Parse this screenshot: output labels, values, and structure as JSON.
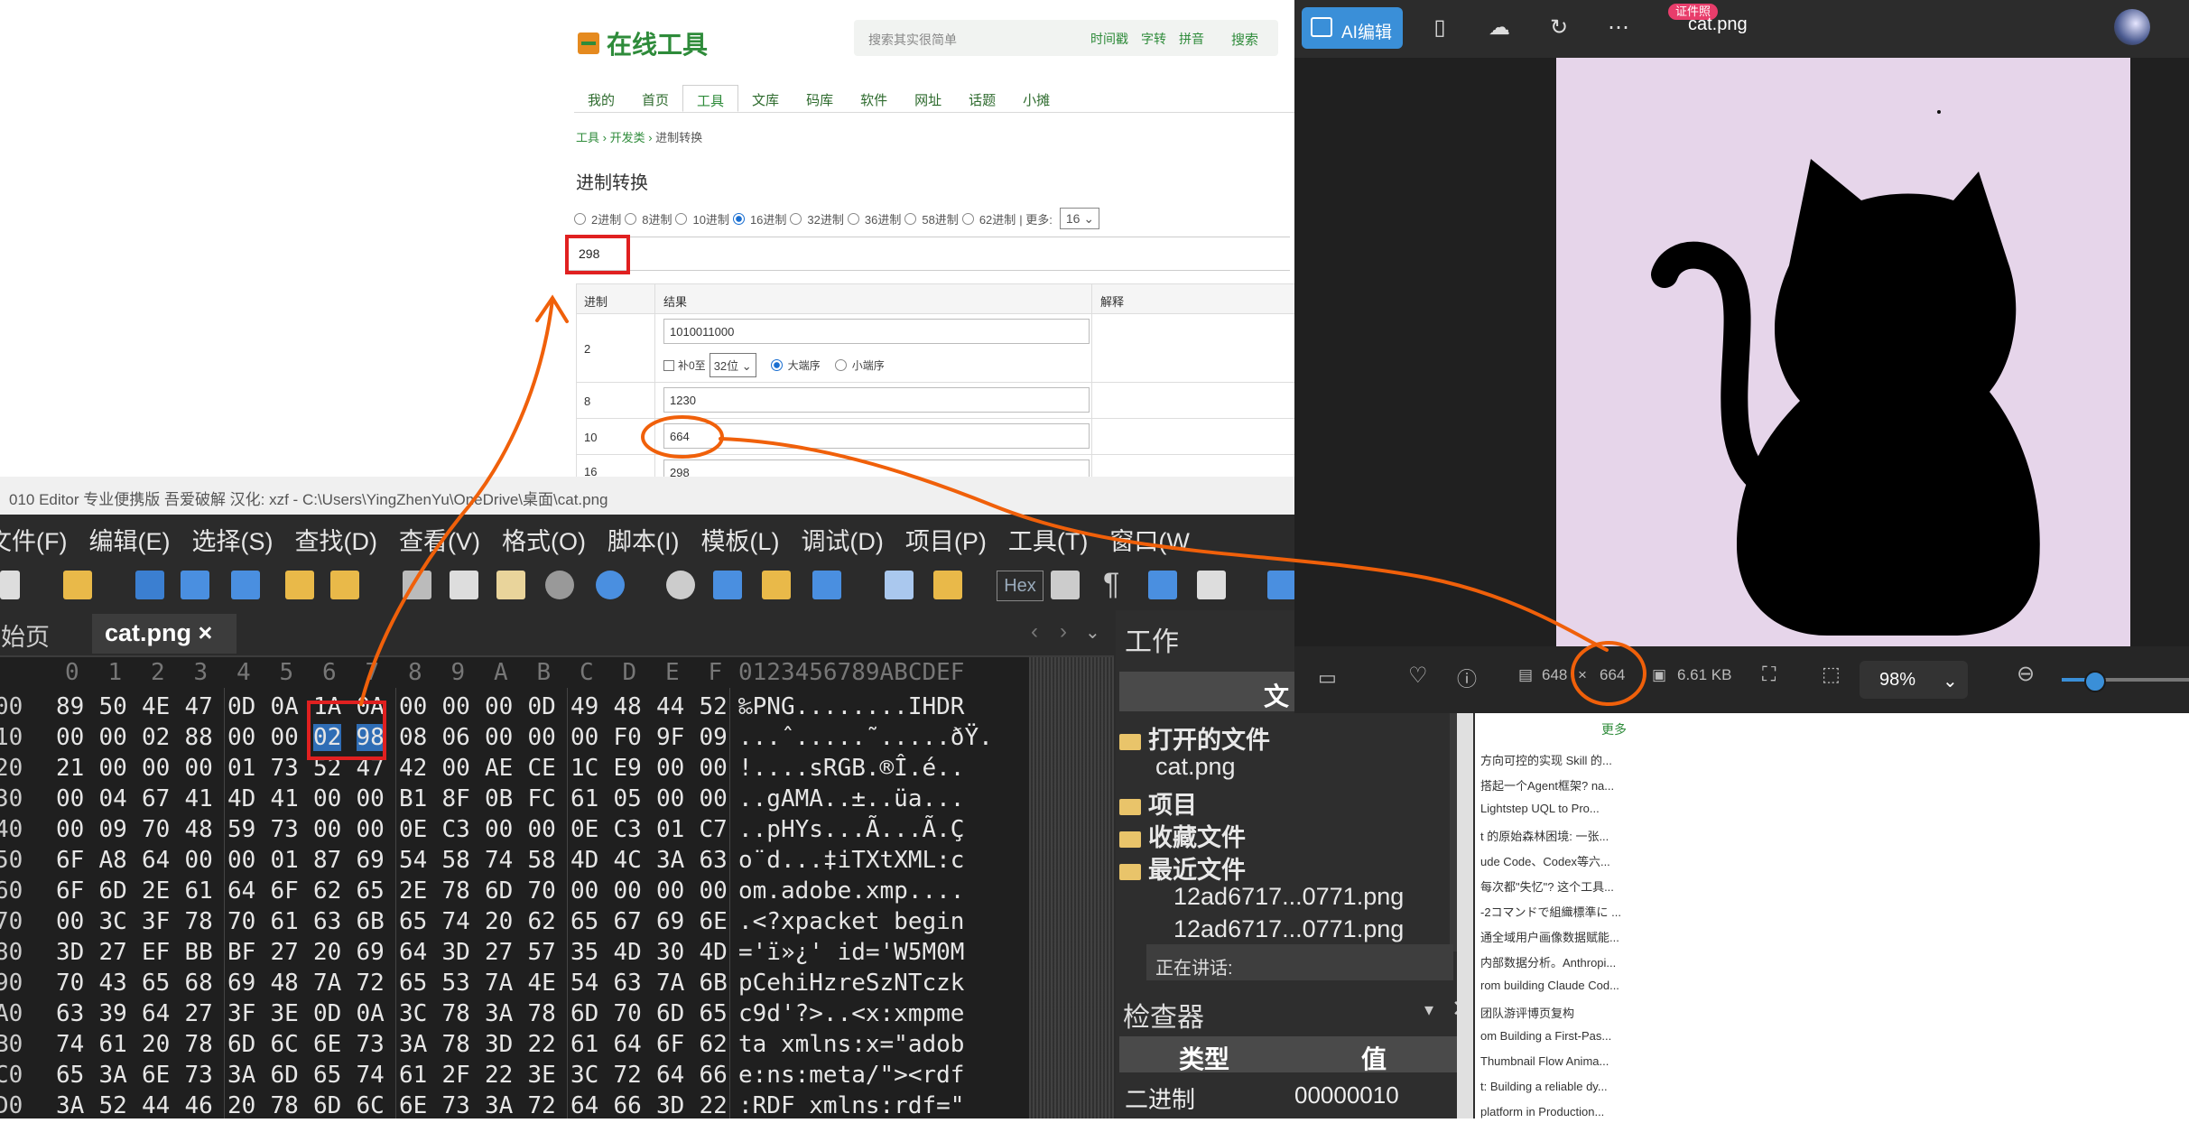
{
  "web": {
    "logo": "在线工具",
    "search_placeholder": "搜索其实很简单",
    "search_chips": [
      "时间戳",
      "字转",
      "拼音"
    ],
    "search_button": "搜索",
    "nav_tabs": [
      "我的",
      "首页",
      "工具",
      "文库",
      "码库",
      "软件",
      "网址",
      "话题",
      "小摊"
    ],
    "active_tab": "工具",
    "breadcrumb": [
      "工具",
      "开发类",
      "进制转换"
    ],
    "section_title": "进制转换",
    "bases": [
      "2进制",
      "8进制",
      "10进制",
      "16进制",
      "32进制",
      "36进制",
      "58进制",
      "62进制"
    ],
    "more_label": "| 更多:",
    "base_select_value": "16",
    "input_value": "298",
    "table_headers": [
      "进制",
      "结果",
      "解释"
    ],
    "rows": [
      {
        "base": "2",
        "value": "1010011000"
      },
      {
        "base": "8",
        "value": "1230"
      },
      {
        "base": "10",
        "value": "664"
      },
      {
        "base": "16",
        "value": "298"
      }
    ],
    "pad_zero_label": "补0至",
    "bit_select": "32位",
    "big_endian": "大端序",
    "little_endian": "小端序"
  },
  "editor": {
    "title": "010 Editor 专业便携版 吾爱破解  汉化: xzf - C:\\Users\\YingZhenYu\\OneDrive\\桌面\\cat.png",
    "menu": [
      "文件(F)",
      "编辑(E)",
      "选择(S)",
      "查找(D)",
      "查看(V)",
      "格式(O)",
      "脚本(I)",
      "模板(L)",
      "调试(D)",
      "项目(P)",
      "工具(T)",
      "窗口(W"
    ],
    "tab_start": "起始页",
    "tab_file": "cat.png ×",
    "hex_label": "Hex",
    "col_header": [
      "0",
      "1",
      "2",
      "3",
      "4",
      "5",
      "6",
      "7",
      "8",
      "9",
      "A",
      "B",
      "C",
      "D",
      "E",
      "F"
    ],
    "ascii_header": "0123456789ABCDEF",
    "rows": [
      {
        "addr": "00",
        "bytes": [
          "89",
          "50",
          "4E",
          "47",
          "0D",
          "0A",
          "1A",
          "0A",
          "00",
          "00",
          "00",
          "0D",
          "49",
          "48",
          "44",
          "52"
        ],
        "ascii": "‰PNG........IHDR"
      },
      {
        "addr": "10",
        "bytes": [
          "00",
          "00",
          "02",
          "88",
          "00",
          "00",
          "02",
          "98",
          "08",
          "06",
          "00",
          "00",
          "00",
          "F0",
          "9F",
          "09"
        ],
        "ascii": "...ˆ.....˜.....ðŸ."
      },
      {
        "addr": "20",
        "bytes": [
          "21",
          "00",
          "00",
          "00",
          "01",
          "73",
          "52",
          "47",
          "42",
          "00",
          "AE",
          "CE",
          "1C",
          "E9",
          "00",
          "00"
        ],
        "ascii": "!....sRGB.®Î.é.."
      },
      {
        "addr": "30",
        "bytes": [
          "00",
          "04",
          "67",
          "41",
          "4D",
          "41",
          "00",
          "00",
          "B1",
          "8F",
          "0B",
          "FC",
          "61",
          "05",
          "00",
          "00"
        ],
        "ascii": "..gAMA..±..üa..."
      },
      {
        "addr": "40",
        "bytes": [
          "00",
          "09",
          "70",
          "48",
          "59",
          "73",
          "00",
          "00",
          "0E",
          "C3",
          "00",
          "00",
          "0E",
          "C3",
          "01",
          "C7"
        ],
        "ascii": "..pHYs...Ã...Ã.Ç"
      },
      {
        "addr": "50",
        "bytes": [
          "6F",
          "A8",
          "64",
          "00",
          "00",
          "01",
          "87",
          "69",
          "54",
          "58",
          "74",
          "58",
          "4D",
          "4C",
          "3A",
          "63"
        ],
        "ascii": "o¨d...‡iTXtXML:c"
      },
      {
        "addr": "60",
        "bytes": [
          "6F",
          "6D",
          "2E",
          "61",
          "64",
          "6F",
          "62",
          "65",
          "2E",
          "78",
          "6D",
          "70",
          "00",
          "00",
          "00",
          "00"
        ],
        "ascii": "om.adobe.xmp...."
      },
      {
        "addr": "70",
        "bytes": [
          "00",
          "3C",
          "3F",
          "78",
          "70",
          "61",
          "63",
          "6B",
          "65",
          "74",
          "20",
          "62",
          "65",
          "67",
          "69",
          "6E"
        ],
        "ascii": ".<?xpacket begin"
      },
      {
        "addr": "80",
        "bytes": [
          "3D",
          "27",
          "EF",
          "BB",
          "BF",
          "27",
          "20",
          "69",
          "64",
          "3D",
          "27",
          "57",
          "35",
          "4D",
          "30",
          "4D"
        ],
        "ascii": "='ï»¿' id='W5M0M"
      },
      {
        "addr": "90",
        "bytes": [
          "70",
          "43",
          "65",
          "68",
          "69",
          "48",
          "7A",
          "72",
          "65",
          "53",
          "7A",
          "4E",
          "54",
          "63",
          "7A",
          "6B"
        ],
        "ascii": "pCehiHzreSzNTczk"
      },
      {
        "addr": "A0",
        "bytes": [
          "63",
          "39",
          "64",
          "27",
          "3F",
          "3E",
          "0D",
          "0A",
          "3C",
          "78",
          "3A",
          "78",
          "6D",
          "70",
          "6D",
          "65"
        ],
        "ascii": "c9d'?>..<x:xmpme"
      },
      {
        "addr": "B0",
        "bytes": [
          "74",
          "61",
          "20",
          "78",
          "6D",
          "6C",
          "6E",
          "73",
          "3A",
          "78",
          "3D",
          "22",
          "61",
          "64",
          "6F",
          "62"
        ],
        "ascii": "ta xmlns:x=\"adob"
      },
      {
        "addr": "C0",
        "bytes": [
          "65",
          "3A",
          "6E",
          "73",
          "3A",
          "6D",
          "65",
          "74",
          "61",
          "2F",
          "22",
          "3E",
          "3C",
          "72",
          "64",
          "66"
        ],
        "ascii": "e:ns:meta/\"><rdf"
      },
      {
        "addr": "D0",
        "bytes": [
          "3A",
          "52",
          "44",
          "46",
          "20",
          "78",
          "6D",
          "6C",
          "6E",
          "73",
          "3A",
          "72",
          "64",
          "66",
          "3D",
          "22"
        ],
        "ascii": ":RDF xmlns:rdf=\""
      }
    ],
    "work_title": "工作",
    "work_col": "文",
    "open_files": "打开的文件",
    "open_file_1": "cat.png",
    "projects": "项目",
    "favorites": "收藏文件",
    "recent": "最近文件",
    "recent_1": "12ad6717...0771.png",
    "recent_2": "12ad6717...0771.png",
    "talking": "正在讲话:",
    "inspector": "检查器",
    "ins_type": "类型",
    "ins_value": "值",
    "ins_row_type": "二进制",
    "ins_row_value": "00000010"
  },
  "viewer": {
    "ai_edit": "AI编辑",
    "badge": "证件照",
    "filename": "cat.png",
    "width": "648",
    "x": "×",
    "height": "664",
    "size": "6.61 KB",
    "zoom": "98%",
    "zoom_fraction": 0.25
  },
  "news": {
    "more": "更多",
    "items": [
      "方向可控的实现 Skill 的...",
      "搭起一个Agent框架? na...",
      "Lightstep UQL to Pro...",
      "t 的原始森林困境: 一张...",
      "ude Code、Codex等六...",
      "每次都\"失忆\"? 这个工具...",
      "-2コマンドで組織標準に ...",
      "通全域用户画像数据赋能...",
      "内部数据分析。Anthropi...",
      "rom building Claude Cod...",
      "团队游评博页复构",
      "om Building a First-Pas...",
      "Thumbnail Flow Anima...",
      "t: Building a reliable dy...",
      "platform in Production..."
    ]
  },
  "colors": {
    "brand_green": "#2e8b3a",
    "annotation_orange": "#f0600a",
    "highlight_red": "#e02020",
    "accent_blue": "#3a8fd8",
    "selection_blue": "#2f6db5",
    "canvas_lilac": "#e6d5ea"
  }
}
